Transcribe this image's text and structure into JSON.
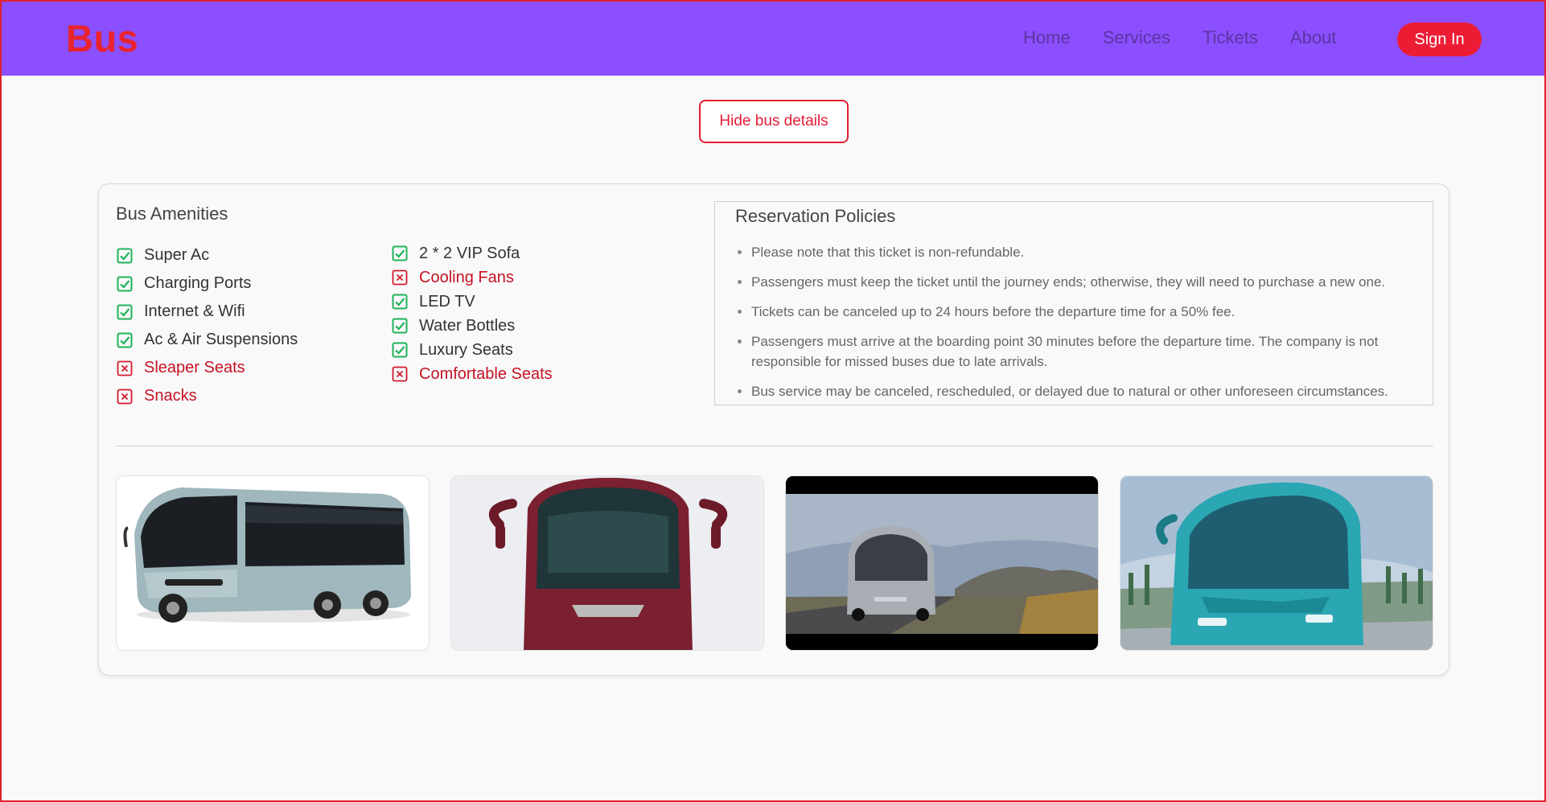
{
  "header": {
    "brand": "Bus",
    "nav": [
      "Home",
      "Services",
      "Tickets",
      "About"
    ],
    "signin": "Sign In",
    "colors": {
      "bar": "#8c4fff",
      "brand": "#e8232e",
      "button": "#ed1c35"
    }
  },
  "toggle_label": "Hide bus details",
  "amenities": {
    "title": "Bus Amenities",
    "column1": [
      {
        "label": "Super Ac",
        "available": true
      },
      {
        "label": "Charging Ports",
        "available": true
      },
      {
        "label": "Internet & Wifi",
        "available": true
      },
      {
        "label": "Ac & Air Suspensions",
        "available": true
      },
      {
        "label": "Sleaper Seats",
        "available": false
      },
      {
        "label": "Snacks",
        "available": false
      }
    ],
    "column2": [
      {
        "label": "2 * 2 VIP Sofa",
        "available": true
      },
      {
        "label": "Cooling Fans",
        "available": false
      },
      {
        "label": "LED TV",
        "available": true
      },
      {
        "label": "Water Bottles",
        "available": true
      },
      {
        "label": "Luxury Seats",
        "available": true
      },
      {
        "label": "Comfortable Seats",
        "available": false
      }
    ],
    "icons": {
      "available": "check-square-icon",
      "unavailable": "x-square-icon"
    }
  },
  "policies": {
    "title": "Reservation Policies",
    "items": [
      "Please note that this ticket is non-refundable.",
      "Passengers must keep the ticket until the journey ends; otherwise, they will need to purchase a new one.",
      "Tickets can be canceled up to 24 hours before the departure time for a 50% fee.",
      "Passengers must arrive at the boarding point 30 minutes before the departure time. The company is not responsible for missed buses due to late arrivals.",
      "Bus service may be canceled, rescheduled, or delayed due to natural or other unforeseen circumstances."
    ]
  },
  "gallery": {
    "photos": [
      "bus-photo-side",
      "bus-photo-front-maroon",
      "bus-photo-road",
      "bus-photo-teal"
    ]
  }
}
